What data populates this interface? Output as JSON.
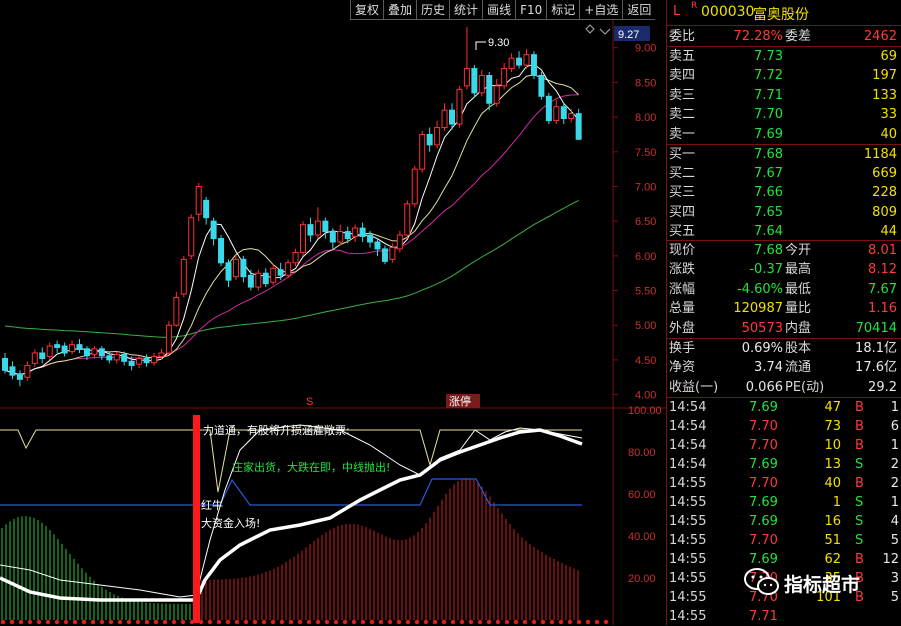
{
  "toolbar": {
    "items": [
      "复权",
      "叠加",
      "历史",
      "统计",
      "画线",
      "F10",
      "标记",
      "+自选",
      "返回"
    ]
  },
  "header": {
    "code_prefix": "L",
    "r_mark": "R",
    "code": "000030",
    "name": "富奥股份"
  },
  "weibi": {
    "label": "委比",
    "value": "72.28%",
    "label2": "委差",
    "value2": "2462"
  },
  "asks": [
    {
      "label": "卖五",
      "price": "7.73",
      "vol": "69"
    },
    {
      "label": "卖四",
      "price": "7.72",
      "vol": "197"
    },
    {
      "label": "卖三",
      "price": "7.71",
      "vol": "133"
    },
    {
      "label": "卖二",
      "price": "7.70",
      "vol": "33"
    },
    {
      "label": "卖一",
      "price": "7.69",
      "vol": "40"
    }
  ],
  "bids": [
    {
      "label": "买一",
      "price": "7.68",
      "vol": "1184"
    },
    {
      "label": "买二",
      "price": "7.67",
      "vol": "669"
    },
    {
      "label": "买三",
      "price": "7.66",
      "vol": "228"
    },
    {
      "label": "买四",
      "price": "7.65",
      "vol": "809"
    },
    {
      "label": "买五",
      "price": "7.64",
      "vol": "44"
    }
  ],
  "stats": [
    {
      "l1": "现价",
      "v1": "7.68",
      "l2": "今开",
      "v2": "8.01"
    },
    {
      "l1": "涨跌",
      "v1": "-0.37",
      "l2": "最高",
      "v2": "8.12"
    },
    {
      "l1": "涨幅",
      "v1": "-4.60%",
      "l2": "最低",
      "v2": "7.67"
    },
    {
      "l1": "总量",
      "v1": "120987",
      "l2": "量比",
      "v2": "1.16"
    },
    {
      "l1": "外盘",
      "v1": "50573",
      "l2": "内盘",
      "v2": "70414"
    }
  ],
  "fund": [
    {
      "l1": "换手",
      "v1": "0.69%",
      "l2": "股本",
      "v2": "18.1亿"
    },
    {
      "l1": "净资",
      "v1": "3.74",
      "l2": "流通",
      "v2": "17.6亿"
    },
    {
      "l1": "收益(一)",
      "v1": "0.066",
      "l2": "PE(动)",
      "v2": "29.2"
    }
  ],
  "ticks": [
    {
      "t": "14:54",
      "p": "7.69",
      "v": "47",
      "bs": "B",
      "n": "1"
    },
    {
      "t": "14:54",
      "p": "7.70",
      "v": "73",
      "bs": "B",
      "n": "6"
    },
    {
      "t": "14:54",
      "p": "7.70",
      "v": "10",
      "bs": "B",
      "n": "1"
    },
    {
      "t": "14:54",
      "p": "7.69",
      "v": "13",
      "bs": "S",
      "n": "2"
    },
    {
      "t": "14:55",
      "p": "7.70",
      "v": "40",
      "bs": "B",
      "n": "2"
    },
    {
      "t": "14:55",
      "p": "7.69",
      "v": "1",
      "bs": "S",
      "n": "1"
    },
    {
      "t": "14:55",
      "p": "7.69",
      "v": "16",
      "bs": "S",
      "n": "4"
    },
    {
      "t": "14:55",
      "p": "7.70",
      "v": "51",
      "bs": "S",
      "n": "5"
    },
    {
      "t": "14:55",
      "p": "7.69",
      "v": "62",
      "bs": "B",
      "n": "12"
    },
    {
      "t": "14:55",
      "p": "7.70",
      "v": "35",
      "bs": "B",
      "n": "3"
    },
    {
      "t": "14:55",
      "p": "7.70",
      "v": "101",
      "bs": "B",
      "n": "5"
    },
    {
      "t": "14:55",
      "p": "7.71",
      "v": "",
      "bs": "",
      "n": ""
    }
  ],
  "chart_labels": {
    "price_current": "9.27",
    "peak_label": "9.30",
    "s_marker": "S",
    "zhangting": "涨停",
    "hongniu": "红牛",
    "dazijin": "大资金入场!",
    "zhuangjia": "庄家出货，大跌在即，中线抛出!",
    "top_cut": "力道通，有股将升损涵雇敞票:"
  },
  "watermark": {
    "text": "指标超市"
  },
  "chart_data": {
    "type": "candlestick",
    "price_axis": {
      "ticks": [
        "9.00",
        "8.50",
        "8.00",
        "7.50",
        "7.00",
        "6.50",
        "6.00",
        "5.50",
        "5.00",
        "4.50",
        "4.00"
      ],
      "range": [
        3.85,
        9.4
      ]
    },
    "indicator_axis": {
      "ticks": [
        "100.00",
        "80.00",
        "60.00",
        "40.00",
        "20.00"
      ],
      "range": [
        0,
        100
      ]
    },
    "candles": [
      {
        "o": 4.52,
        "c": 4.35,
        "h": 4.6,
        "l": 4.3
      },
      {
        "o": 4.4,
        "c": 4.28,
        "h": 4.48,
        "l": 4.22
      },
      {
        "o": 4.3,
        "c": 4.22,
        "h": 4.35,
        "l": 4.12
      },
      {
        "o": 4.25,
        "c": 4.42,
        "h": 4.48,
        "l": 4.2
      },
      {
        "o": 4.45,
        "c": 4.6,
        "h": 4.65,
        "l": 4.4
      },
      {
        "o": 4.6,
        "c": 4.52,
        "h": 4.68,
        "l": 4.45
      },
      {
        "o": 4.55,
        "c": 4.7,
        "h": 4.75,
        "l": 4.5
      },
      {
        "o": 4.72,
        "c": 4.68,
        "h": 4.78,
        "l": 4.6
      },
      {
        "o": 4.7,
        "c": 4.6,
        "h": 4.75,
        "l": 4.55
      },
      {
        "o": 4.62,
        "c": 4.72,
        "h": 4.78,
        "l": 4.58
      },
      {
        "o": 4.72,
        "c": 4.65,
        "h": 4.8,
        "l": 4.6
      },
      {
        "o": 4.66,
        "c": 4.56,
        "h": 4.7,
        "l": 4.5
      },
      {
        "o": 4.58,
        "c": 4.66,
        "h": 4.7,
        "l": 4.52
      },
      {
        "o": 4.66,
        "c": 4.56,
        "h": 4.7,
        "l": 4.5
      },
      {
        "o": 4.56,
        "c": 4.5,
        "h": 4.62,
        "l": 4.45
      },
      {
        "o": 4.5,
        "c": 4.58,
        "h": 4.62,
        "l": 4.45
      },
      {
        "o": 4.58,
        "c": 4.48,
        "h": 4.62,
        "l": 4.42
      },
      {
        "o": 4.48,
        "c": 4.42,
        "h": 4.55,
        "l": 4.35
      },
      {
        "o": 4.44,
        "c": 4.52,
        "h": 4.56,
        "l": 4.38
      },
      {
        "o": 4.52,
        "c": 4.46,
        "h": 4.58,
        "l": 4.4
      },
      {
        "o": 4.46,
        "c": 4.55,
        "h": 4.6,
        "l": 4.42
      },
      {
        "o": 4.55,
        "c": 4.6,
        "h": 4.66,
        "l": 4.5
      },
      {
        "o": 4.6,
        "c": 5.0,
        "h": 5.06,
        "l": 4.58
      },
      {
        "o": 5.0,
        "c": 5.4,
        "h": 5.48,
        "l": 4.98
      },
      {
        "o": 5.45,
        "c": 5.95,
        "h": 6.0,
        "l": 5.4
      },
      {
        "o": 6.0,
        "c": 6.55,
        "h": 6.6,
        "l": 5.95
      },
      {
        "o": 6.6,
        "c": 7.0,
        "h": 7.05,
        "l": 6.5
      },
      {
        "o": 6.8,
        "c": 6.55,
        "h": 6.85,
        "l": 6.45
      },
      {
        "o": 6.5,
        "c": 6.25,
        "h": 6.55,
        "l": 6.15
      },
      {
        "o": 6.25,
        "c": 5.9,
        "h": 6.3,
        "l": 5.85
      },
      {
        "o": 5.9,
        "c": 5.65,
        "h": 5.95,
        "l": 5.55
      },
      {
        "o": 5.7,
        "c": 5.95,
        "h": 6.02,
        "l": 5.65
      },
      {
        "o": 5.95,
        "c": 5.7,
        "h": 6.0,
        "l": 5.62
      },
      {
        "o": 5.72,
        "c": 5.55,
        "h": 5.8,
        "l": 5.5
      },
      {
        "o": 5.55,
        "c": 5.75,
        "h": 5.8,
        "l": 5.5
      },
      {
        "o": 5.75,
        "c": 5.6,
        "h": 5.82,
        "l": 5.55
      },
      {
        "o": 5.62,
        "c": 5.82,
        "h": 5.88,
        "l": 5.58
      },
      {
        "o": 5.8,
        "c": 5.72,
        "h": 5.9,
        "l": 5.65
      },
      {
        "o": 5.72,
        "c": 5.9,
        "h": 5.95,
        "l": 5.68
      },
      {
        "o": 5.9,
        "c": 6.05,
        "h": 6.1,
        "l": 5.85
      },
      {
        "o": 6.05,
        "c": 6.45,
        "h": 6.5,
        "l": 6.0
      },
      {
        "o": 6.45,
        "c": 6.3,
        "h": 6.55,
        "l": 6.2
      },
      {
        "o": 6.3,
        "c": 6.5,
        "h": 6.7,
        "l": 6.25
      },
      {
        "o": 6.5,
        "c": 6.35,
        "h": 6.55,
        "l": 6.25
      },
      {
        "o": 6.35,
        "c": 6.2,
        "h": 6.4,
        "l": 6.1
      },
      {
        "o": 6.2,
        "c": 6.35,
        "h": 6.45,
        "l": 6.15
      },
      {
        "o": 6.35,
        "c": 6.25,
        "h": 6.42,
        "l": 6.18
      },
      {
        "o": 6.28,
        "c": 6.4,
        "h": 6.45,
        "l": 6.2
      },
      {
        "o": 6.4,
        "c": 6.28,
        "h": 6.48,
        "l": 6.2
      },
      {
        "o": 6.3,
        "c": 6.2,
        "h": 6.36,
        "l": 6.12
      },
      {
        "o": 6.2,
        "c": 6.1,
        "h": 6.26,
        "l": 6.0
      },
      {
        "o": 6.1,
        "c": 5.92,
        "h": 6.15,
        "l": 5.88
      },
      {
        "o": 5.95,
        "c": 6.12,
        "h": 6.18,
        "l": 5.9
      },
      {
        "o": 6.1,
        "c": 6.3,
        "h": 6.36,
        "l": 6.05
      },
      {
        "o": 6.3,
        "c": 6.75,
        "h": 6.8,
        "l": 6.25
      },
      {
        "o": 6.75,
        "c": 7.25,
        "h": 7.3,
        "l": 6.7
      },
      {
        "o": 7.25,
        "c": 7.75,
        "h": 7.8,
        "l": 7.2
      },
      {
        "o": 7.75,
        "c": 7.6,
        "h": 7.85,
        "l": 7.5
      },
      {
        "o": 7.6,
        "c": 7.85,
        "h": 7.95,
        "l": 7.55
      },
      {
        "o": 7.85,
        "c": 8.1,
        "h": 8.2,
        "l": 7.8
      },
      {
        "o": 8.1,
        "c": 7.9,
        "h": 8.2,
        "l": 7.82
      },
      {
        "o": 7.9,
        "c": 8.4,
        "h": 8.45,
        "l": 7.85
      },
      {
        "o": 8.45,
        "c": 8.7,
        "h": 9.3,
        "l": 8.4
      },
      {
        "o": 8.7,
        "c": 8.35,
        "h": 8.75,
        "l": 8.28
      },
      {
        "o": 8.35,
        "c": 8.6,
        "h": 8.68,
        "l": 8.3
      },
      {
        "o": 8.6,
        "c": 8.2,
        "h": 8.65,
        "l": 8.1
      },
      {
        "o": 8.2,
        "c": 8.45,
        "h": 8.55,
        "l": 8.15
      },
      {
        "o": 8.45,
        "c": 8.7,
        "h": 8.78,
        "l": 8.4
      },
      {
        "o": 8.7,
        "c": 8.85,
        "h": 8.92,
        "l": 8.65
      },
      {
        "o": 8.85,
        "c": 8.75,
        "h": 8.95,
        "l": 8.7
      },
      {
        "o": 8.75,
        "c": 8.9,
        "h": 8.98,
        "l": 8.7
      },
      {
        "o": 8.9,
        "c": 8.6,
        "h": 8.95,
        "l": 8.55
      },
      {
        "o": 8.6,
        "c": 8.3,
        "h": 8.65,
        "l": 8.25
      },
      {
        "o": 8.3,
        "c": 7.95,
        "h": 8.35,
        "l": 7.9
      },
      {
        "o": 7.95,
        "c": 8.15,
        "h": 8.25,
        "l": 7.9
      },
      {
        "o": 8.15,
        "c": 7.98,
        "h": 8.2,
        "l": 7.9
      },
      {
        "o": 7.98,
        "c": 8.05,
        "h": 8.12,
        "l": 7.92
      },
      {
        "o": 8.05,
        "c": 7.68,
        "h": 8.12,
        "l": 7.67
      }
    ]
  }
}
